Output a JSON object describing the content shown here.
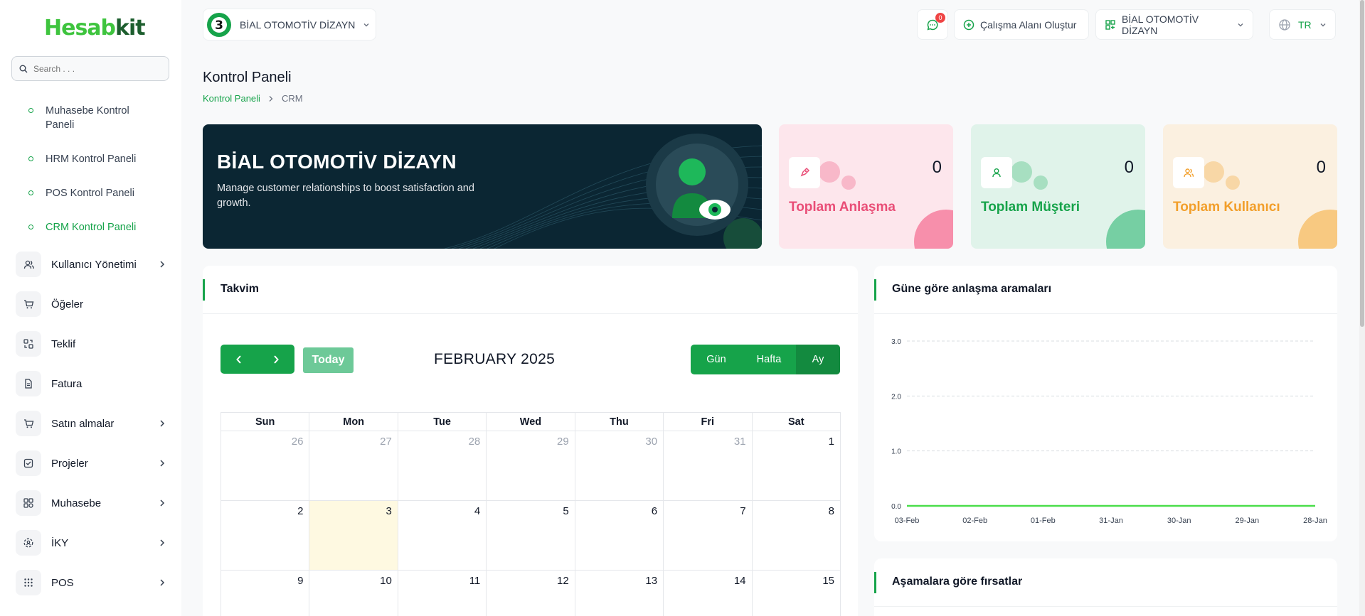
{
  "brand": {
    "part1": "Hesab",
    "part2": "kit",
    "accent": "#16a34a"
  },
  "search": {
    "placeholder": "Search . . ."
  },
  "sidebar": {
    "sub_items": [
      {
        "label": "Muhasebe Kontrol Paneli",
        "active": false
      },
      {
        "label": "HRM Kontrol Paneli",
        "active": false
      },
      {
        "label": "POS Kontrol Paneli",
        "active": false
      },
      {
        "label": "CRM Kontrol Paneli",
        "active": true
      }
    ],
    "items": [
      {
        "label": "Kullanıcı Yönetimi",
        "icon": "users-icon",
        "chevron": true
      },
      {
        "label": "Öğeler",
        "icon": "cart-icon",
        "chevron": false
      },
      {
        "label": "Teklif",
        "icon": "exchange-icon",
        "chevron": false
      },
      {
        "label": "Fatura",
        "icon": "file-icon",
        "chevron": false
      },
      {
        "label": "Satın almalar",
        "icon": "cart-icon",
        "chevron": true
      },
      {
        "label": "Projeler",
        "icon": "checkbox-icon",
        "chevron": true
      },
      {
        "label": "Muhasebe",
        "icon": "grid-icon",
        "chevron": true
      },
      {
        "label": "İKY",
        "icon": "hrm-icon",
        "chevron": true
      },
      {
        "label": "POS",
        "icon": "dots-grid-icon",
        "chevron": true
      }
    ]
  },
  "topbar": {
    "workspace": "BİAL OTOMOTİV DİZAYN",
    "notifications_count": "0",
    "create_workspace": "Çalışma Alanı Oluştur",
    "company": "BİAL OTOMOTİV DİZAYN",
    "language": "TR"
  },
  "page": {
    "title": "Kontrol Paneli",
    "breadcrumb": [
      "Kontrol Paneli",
      "CRM"
    ]
  },
  "banner": {
    "title": "BİAL OTOMOTİV DİZAYN",
    "subtitle": "Manage customer relationships to boost satisfaction and growth."
  },
  "stats": [
    {
      "label": "Toplam Anlaşma",
      "value": "0",
      "color": "#e94e77",
      "bg": "#fde6ec",
      "bub": "#f8b8c9",
      "corner": "#f78fab"
    },
    {
      "label": "Toplam Müşteri",
      "value": "0",
      "color": "#16a34a",
      "bg": "#e0f3ea",
      "bub": "#a7dfc1",
      "corner": "#76cfa3"
    },
    {
      "label": "Toplam Kullanıcı",
      "value": "0",
      "color": "#f29f2b",
      "bg": "#fbf0e0",
      "bub": "#f8d7a6",
      "corner": "#f8c981"
    }
  ],
  "calendar": {
    "title": "Takvim",
    "today_label": "Today",
    "month_label": "FEBRUARY 2025",
    "views": [
      "Gün",
      "Hafta",
      "Ay"
    ],
    "weekdays": [
      "Sun",
      "Mon",
      "Tue",
      "Wed",
      "Thu",
      "Fri",
      "Sat"
    ],
    "rows": [
      [
        {
          "d": "26",
          "other": true
        },
        {
          "d": "27",
          "other": true
        },
        {
          "d": "28",
          "other": true
        },
        {
          "d": "29",
          "other": true
        },
        {
          "d": "30",
          "other": true
        },
        {
          "d": "31",
          "other": true
        },
        {
          "d": "1",
          "other": false
        }
      ],
      [
        {
          "d": "2",
          "other": false
        },
        {
          "d": "3",
          "other": false,
          "today": true
        },
        {
          "d": "4",
          "other": false
        },
        {
          "d": "5",
          "other": false
        },
        {
          "d": "6",
          "other": false
        },
        {
          "d": "7",
          "other": false
        },
        {
          "d": "8",
          "other": false
        }
      ],
      [
        {
          "d": "9",
          "other": false
        },
        {
          "d": "10",
          "other": false
        },
        {
          "d": "11",
          "other": false
        },
        {
          "d": "12",
          "other": false
        },
        {
          "d": "13",
          "other": false
        },
        {
          "d": "14",
          "other": false
        },
        {
          "d": "15",
          "other": false
        }
      ]
    ]
  },
  "deals_card": {
    "title": "Güne göre anlaşma aramaları"
  },
  "stages_card": {
    "title": "Aşamalara göre fırsatlar"
  },
  "chart_data": {
    "type": "area",
    "categories": [
      "03-Feb",
      "02-Feb",
      "01-Feb",
      "31-Jan",
      "30-Jan",
      "29-Jan",
      "28-Jan"
    ],
    "series": [
      {
        "values": [
          0,
          0,
          0,
          0,
          0,
          0,
          0
        ]
      }
    ],
    "yticks": [
      "0.0",
      "1.0",
      "2.0",
      "3.0"
    ],
    "ylim": [
      0,
      3
    ],
    "grid": true,
    "color": "#4ade4a"
  }
}
